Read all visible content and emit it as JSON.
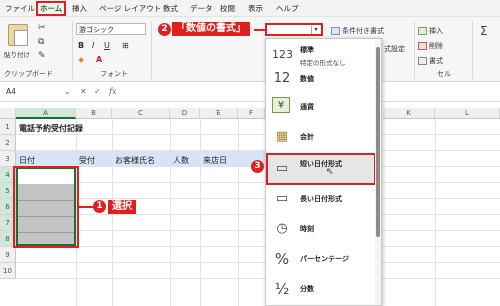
{
  "menu": {
    "tabs": [
      "ファイル",
      "ホーム",
      "挿入",
      "ページ レイアウト",
      "数式",
      "データ",
      "校閲",
      "表示",
      "ヘルプ"
    ],
    "active_tab": "ホーム"
  },
  "ribbon": {
    "paste_label": "貼り付け",
    "clipboard_label": "クリップボード",
    "font_name": "游ゴシック",
    "font_label": "フォント",
    "conditional_format": "条件付き書式",
    "cell_styles_fragment": "式設定",
    "insert": "挿入",
    "delete": "削除",
    "format": "書式",
    "cells_label": "セル"
  },
  "callouts": {
    "c1_number": "1",
    "c1_text": "選択",
    "c2_number": "2",
    "c2_text": "「数値の書式」",
    "c3_number": "3"
  },
  "formula_bar": {
    "name_box": "A4",
    "fx": "fx"
  },
  "sheet": {
    "columns": [
      "A",
      "B",
      "C",
      "D",
      "E",
      "F",
      "G"
    ],
    "rows": [
      "1",
      "2",
      "3",
      "4",
      "5",
      "6",
      "7",
      "8",
      "9",
      "10"
    ],
    "title": "電話予約受付記録",
    "headers": [
      "日付",
      "受付",
      "お客様氏名",
      "人数",
      "来店日"
    ],
    "right_columns": [
      "K",
      "L"
    ]
  },
  "number_format_menu": {
    "items": [
      {
        "icon": "123",
        "label": "標準",
        "sub": "特定の形式なし"
      },
      {
        "icon": "12",
        "label": "数値",
        "sub": ""
      },
      {
        "icon": "¥",
        "label": "通貨",
        "sub": ""
      },
      {
        "icon": "▦",
        "label": "会計",
        "sub": ""
      },
      {
        "icon": "▭",
        "label": "短い日付形式",
        "sub": ""
      },
      {
        "icon": "▭",
        "label": "長い日付形式",
        "sub": ""
      },
      {
        "icon": "◷",
        "label": "時刻",
        "sub": ""
      },
      {
        "icon": "%",
        "label": "パーセンテージ",
        "sub": ""
      },
      {
        "icon": "½",
        "label": "分数",
        "sub": ""
      }
    ]
  },
  "colors": {
    "accent_red": "#e0201f",
    "excel_green": "#1b6e34",
    "header_fill": "#d6e4f5",
    "selection_fill": "#c4c4c4"
  }
}
